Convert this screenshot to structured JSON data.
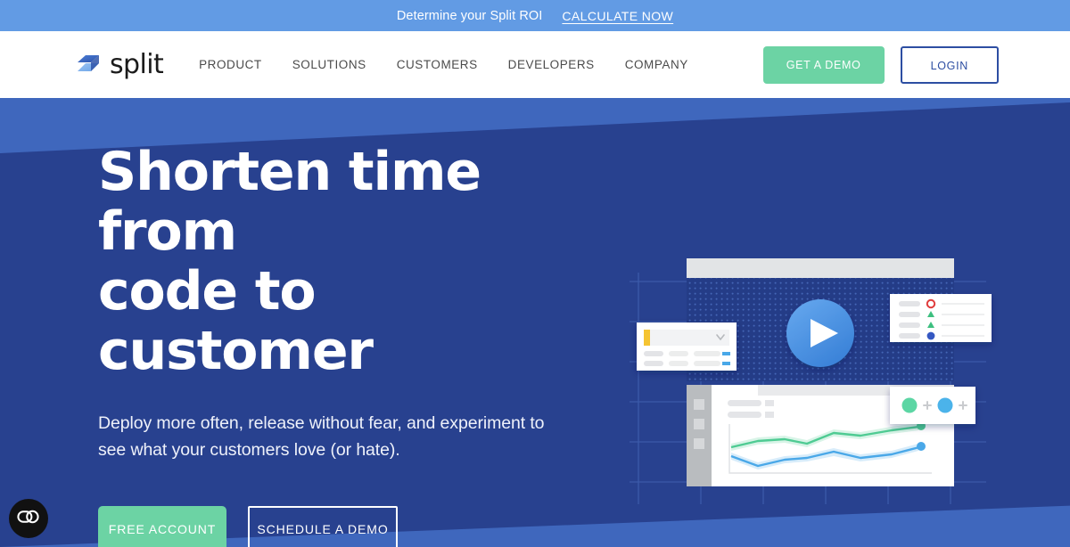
{
  "announcement": {
    "text": "Determine your Split ROI",
    "link_label": "CALCULATE NOW",
    "background_color": "#629be4"
  },
  "header": {
    "brand": {
      "word": "split",
      "logo_icon": "split-logo-icon"
    },
    "nav": [
      {
        "label": "PRODUCT"
      },
      {
        "label": "SOLUTIONS"
      },
      {
        "label": "CUSTOMERS"
      },
      {
        "label": "DEVELOPERS"
      },
      {
        "label": "COMPANY"
      }
    ],
    "actions": {
      "demo_label": "GET A DEMO",
      "demo_color": "#6cd3a4",
      "login_label": "LOGIN",
      "login_color": "#2d4ea2"
    }
  },
  "hero": {
    "title_line1": "Shorten time from",
    "title_line2": "code to customer",
    "subtitle": "Deploy more often, release without fear, and experiment to see what your customers love (or hate).",
    "cta_primary": "FREE ACCOUNT",
    "cta_secondary": "SCHEDULE A DEMO",
    "background_color": "#28418f",
    "accent_color": "#3f67bd",
    "artwork": {
      "play_button_icon": "play-icon",
      "status_card": {
        "rows": [
          {
            "indicator": "circle-outline-red",
            "color": "#e03b3b"
          },
          {
            "indicator": "triangle-up-green",
            "color": "#3cbf7f"
          },
          {
            "indicator": "triangle-up-green",
            "color": "#3cbf7f"
          },
          {
            "indicator": "circle-filled-blue",
            "color": "#3558c2"
          }
        ]
      },
      "dropdown_card": {
        "accent_color": "#f5c432",
        "chevron_icon": "chevron-down-icon",
        "rows": 2,
        "toggle_color": "#4aa8e8"
      },
      "avatar_card": {
        "items": [
          {
            "dot_color": "#5cd6a4",
            "add_icon": "plus-icon"
          },
          {
            "dot_color": "#4cb3ea",
            "add_icon": "plus-icon"
          }
        ]
      },
      "chart_card": {
        "series": [
          {
            "name": "green-trend",
            "color": "#4fcb93"
          },
          {
            "name": "blue-trend",
            "color": "#4aa8e8"
          }
        ]
      }
    }
  },
  "cookie_widget": {
    "icon": "cookie-consent-icon",
    "background_color": "#111111"
  }
}
